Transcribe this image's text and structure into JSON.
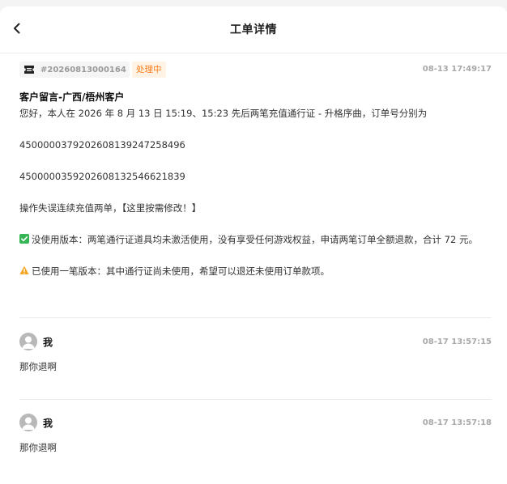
{
  "header": {
    "title": "工单详情"
  },
  "ticket": {
    "number": "#20260813000164",
    "status": "处理中",
    "status_color": "#ff7d1a",
    "time": "08-13 17:49:17",
    "icon": "ticket-icon",
    "title": "客户留言-广西/梧州客户",
    "paragraphs": [
      "您好，本人在 2026 年 8 月 13 日 15:19、15:23 先后两笔充值通行证 - 升格序曲，订单号分别为",
      "4500000379202608139247258496",
      "4500000359202608132546621839",
      "操作失误连续充值两单，【这里按需修改！】"
    ],
    "option_unused": {
      "icon": "check-box-icon",
      "text": "没使用版本：两笔通行证道具均未激活使用，没有享受任何游戏权益，申请两笔订单全额退款，合计 72 元。"
    },
    "option_used": {
      "icon": "warning-icon",
      "text": "已使用一笔版本：其中通行证尚未使用，希望可以退还未使用订单款项。"
    }
  },
  "replies": [
    {
      "name": "我",
      "time": "08-17 13:57:15",
      "text": "那你退啊"
    },
    {
      "name": "我",
      "time": "08-17 13:57:18",
      "text": "那你退啊"
    }
  ]
}
